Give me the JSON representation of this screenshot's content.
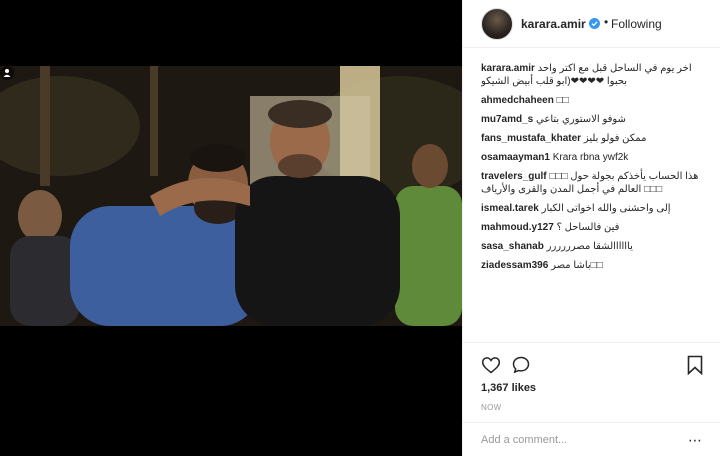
{
  "header": {
    "username": "karara.amir",
    "separator": "•",
    "follow_label": "Following"
  },
  "comments": [
    {
      "user": "karara.amir",
      "text": "اخر يوم في الساحل قبل مع اكتر واحد بحبوا ❤❤❤❤(ابو قلب أبيض الشيكو"
    },
    {
      "user": "ahmedchaheen",
      "text": "□□"
    },
    {
      "user": "mu7amd_s",
      "text": "شوفو الاستوري بتاعي"
    },
    {
      "user": "fans_mustafa_khater",
      "text": "ممكن فولو بليز"
    },
    {
      "user": "osamaayman1",
      "text": "Krara rbna ywf2k"
    },
    {
      "user": "travelers_gulf",
      "text": "هذا الحساب يأخذكم بجولة حول □□□ □□□ العالم في أجمل المدن والقرى والأرياف"
    },
    {
      "user": "ismeal.tarek",
      "text": "إلى واحشنى والله اخواتى الكبار"
    },
    {
      "user": "mahmoud.y127",
      "text": "فين فالساحل ؟"
    },
    {
      "user": "sasa_shanab",
      "text": "ياااااالشقا مصرررررر"
    },
    {
      "user": "ziadessam396",
      "text": "باشا مصر□□"
    }
  ],
  "actions": {
    "likes": "1,367 likes",
    "time": "NOW"
  },
  "add_comment": {
    "placeholder": "Add a comment..."
  },
  "icons": {
    "like": "heart-icon",
    "comment": "comment-icon",
    "save": "bookmark-icon",
    "more": "more-options-icon",
    "verified": "verified-badge-icon",
    "user_tag": "user-tag-icon"
  },
  "colors": {
    "verified": "#3897f0",
    "text": "#262626",
    "muted": "#999999"
  }
}
